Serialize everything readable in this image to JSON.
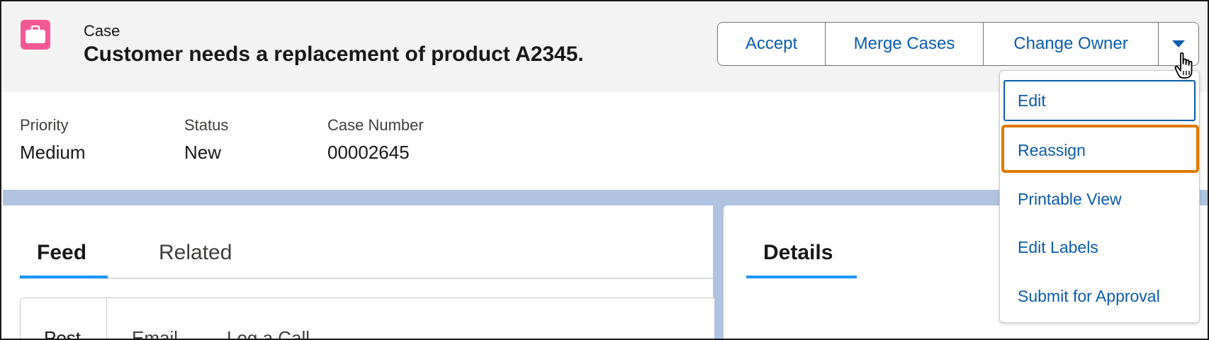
{
  "header": {
    "object_label": "Case",
    "record_title": "Customer needs a replacement of product A2345.",
    "icon": "briefcase-icon",
    "icon_color": "#f45995"
  },
  "actions": {
    "accept_label": "Accept",
    "merge_label": "Merge Cases",
    "change_owner_label": "Change Owner",
    "more_icon": "chevron-down-icon"
  },
  "menu": {
    "items": [
      {
        "label": "Edit",
        "state": "focused"
      },
      {
        "label": "Reassign",
        "state": "highlighted"
      },
      {
        "label": "Printable View"
      },
      {
        "label": "Edit Labels"
      },
      {
        "label": "Submit for Approval"
      }
    ]
  },
  "highlights": {
    "fields": [
      {
        "label": "Priority",
        "value": "Medium"
      },
      {
        "label": "Status",
        "value": "New"
      },
      {
        "label": "Case Number",
        "value": "00002645"
      }
    ]
  },
  "tabs": {
    "feed_label": "Feed",
    "related_label": "Related",
    "details_label": "Details"
  },
  "publisher": {
    "tabs": [
      "Post",
      "Email",
      "Log a Call"
    ]
  },
  "colors": {
    "link_blue": "#0b5cab",
    "tab_active": "#1b96ff",
    "highlight_orange": "#dd7a01",
    "band": "#b0c4df"
  }
}
